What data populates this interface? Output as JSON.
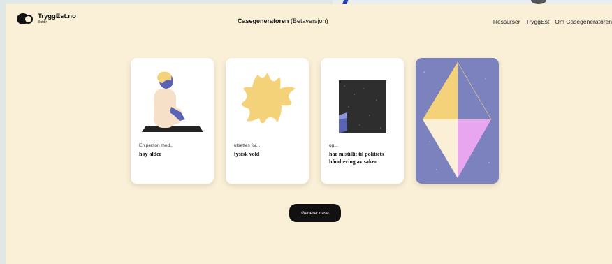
{
  "header": {
    "logo_name": "TryggEst.no",
    "logo_sub": "Bufdir",
    "title_main": "Casegeneratoren",
    "title_suffix": "(Betaversjon)",
    "nav": [
      "Ressurser",
      "TryggEst",
      "Om Casegeneratoren"
    ]
  },
  "cards": [
    {
      "prefix": "En person med...",
      "value": "høy alder"
    },
    {
      "prefix": "utsettes for...",
      "value": "fysisk vold"
    },
    {
      "prefix": "og...",
      "value": "har mistillit til politiets håndtering av saken"
    }
  ],
  "generate_label": "Generer case",
  "colors": {
    "page_bg": "#faf0d8",
    "card_bg": "#ffffff",
    "button_bg": "#111111",
    "art_card_bg": "#7b82bd",
    "accent_yellow": "#f3d27a",
    "accent_pink": "#e8a6f0",
    "accent_blue": "#5b63b5"
  },
  "icons": [
    "meditating-person-icon",
    "star-burst-icon",
    "dark-door-icon",
    "diamond-shape-icon"
  ]
}
